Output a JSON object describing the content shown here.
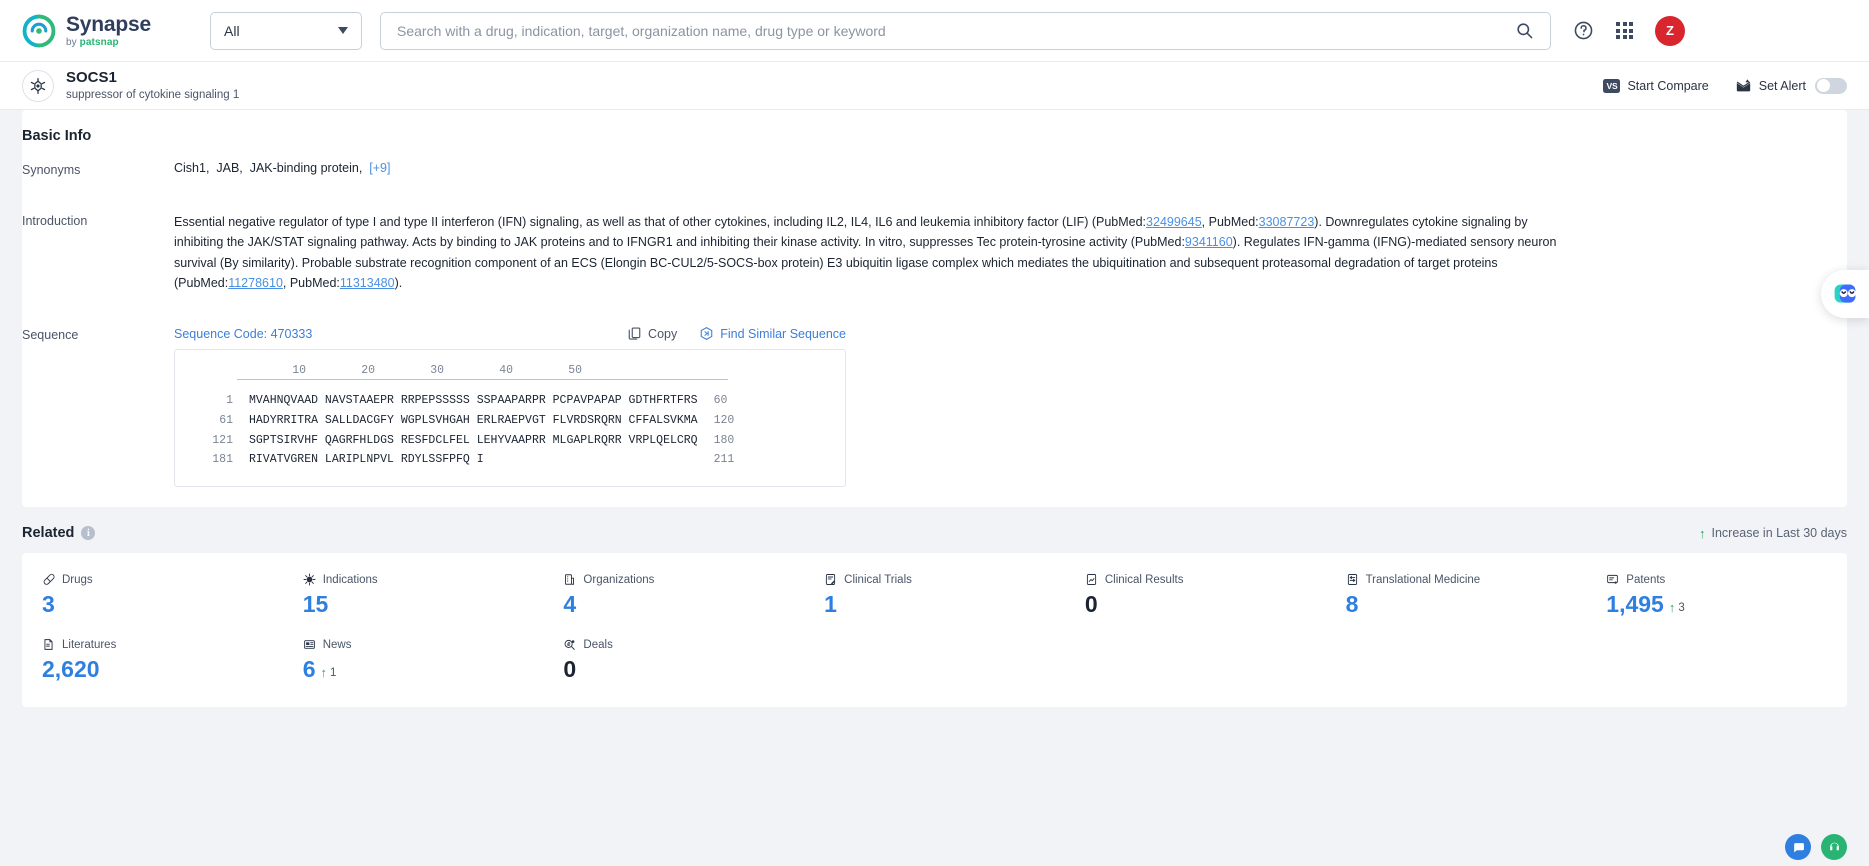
{
  "topbar": {
    "brand_name": "Synapse",
    "brand_by": "by",
    "brand_company": "patsnap",
    "scope_value": "All",
    "search_placeholder": "Search with a drug, indication, target, organization name, drug type or keyword",
    "search_value": "",
    "help_icon": "question-circle-icon",
    "apps_icon": "grid-apps-icon",
    "avatar_initial": "Z"
  },
  "titlebar": {
    "target_icon": "target-crosshair-icon",
    "name": "SOCS1",
    "full_name": "suppressor of cytokine signaling 1",
    "start_compare_label": "Start Compare",
    "vs_badge": "VS",
    "set_alert_label": "Set Alert",
    "alert_enabled": false
  },
  "basic_info": {
    "section_title": "Basic Info",
    "synonyms_label": "Synonyms",
    "synonyms": [
      "Cish1",
      "JAB",
      "JAK-binding protein"
    ],
    "synonyms_more": "[+9]",
    "introduction_label": "Introduction",
    "introduction": {
      "p1": "Essential negative regulator of type I and type II interferon (IFN) signaling, as well as that of other cytokines, including IL2, IL4, IL6 and leukemia inhibitory factor (LIF) (PubMed:",
      "pm1": "32499645",
      "p2": ", PubMed:",
      "pm2": "33087723",
      "p3": "). Downregulates cytokine signaling by inhibiting the JAK/STAT signaling pathway. Acts by binding to JAK proteins and to IFNGR1 and inhibiting their kinase activity. In vitro, suppresses Tec protein-tyrosine activity (PubMed:",
      "pm3": "9341160",
      "p4": "). Regulates IFN-gamma (IFNG)-mediated sensory neuron survival (By similarity). Probable substrate recognition component of an ECS (Elongin BC-CUL2/5-SOCS-box protein) E3 ubiquitin ligase complex which mediates the ubiquitination and subsequent proteasomal degradation of target proteins (PubMed:",
      "pm4": "11278610",
      "p5": ", PubMed:",
      "pm5": "11313480",
      "p6": ")."
    },
    "sequence_label": "Sequence",
    "sequence_code": "Sequence Code: 470333",
    "copy_label": "Copy",
    "copy_icon": "copy-icon",
    "find_similar_label": "Find Similar Sequence",
    "find_similar_icon": "hexagon-similar-icon",
    "sequence_ruler": "        10        20        30        40        50",
    "sequence_rows": [
      {
        "start": "1",
        "blocks": "MVAHNQVAAD NAVSTAAEPR RRPEPSSSSS SSPAAPARPR PCPAVPAPAP GDTHFRTFRS",
        "end": "60"
      },
      {
        "start": "61",
        "blocks": "HADYRRITRA SALLDACGFY WGPLSVHGAH ERLRAEPVGT FLVRDSRQRN CFFALSVKMA",
        "end": "120"
      },
      {
        "start": "121",
        "blocks": "SGPTSIRVHF QAGRFHLDGS RESFDCLFEL LEHYVAAPRR MLGAPLRQRR VRPLQELCRQ",
        "end": "180"
      },
      {
        "start": "181",
        "blocks": "RIVATVGREN LARIPLNPVL RDYLSSFPFQ I",
        "end": "211"
      }
    ]
  },
  "related": {
    "title": "Related",
    "info_icon": "info-circle-icon",
    "legend": "Increase in Last 30 days",
    "legend_icon": "arrow-up-icon",
    "stats": [
      {
        "label": "Drugs",
        "icon": "pill-icon",
        "value": "3",
        "delta": null,
        "zero": false
      },
      {
        "label": "Indications",
        "icon": "virus-icon",
        "value": "15",
        "delta": null,
        "zero": false
      },
      {
        "label": "Organizations",
        "icon": "building-icon",
        "value": "4",
        "delta": null,
        "zero": false
      },
      {
        "label": "Clinical Trials",
        "icon": "clinical-trial-icon",
        "value": "1",
        "delta": null,
        "zero": false
      },
      {
        "label": "Clinical Results",
        "icon": "clinical-result-icon",
        "value": "0",
        "delta": null,
        "zero": true
      },
      {
        "label": "Translational Medicine",
        "icon": "translational-icon",
        "value": "8",
        "delta": null,
        "zero": false
      },
      {
        "label": "Patents",
        "icon": "patent-icon",
        "value": "1,495",
        "delta": "3",
        "zero": false
      },
      {
        "label": "Literatures",
        "icon": "literature-icon",
        "value": "2,620",
        "delta": null,
        "zero": false
      },
      {
        "label": "News",
        "icon": "news-icon",
        "value": "6",
        "delta": "1",
        "zero": false
      },
      {
        "label": "Deals",
        "icon": "deals-icon",
        "value": "0",
        "delta": null,
        "zero": true
      }
    ]
  },
  "assistant": {
    "icon": "ai-assistant-icon"
  },
  "colors": {
    "accent_blue": "#2e7fe0",
    "link_blue": "#4a90e2",
    "increase_green": "#2eaa55",
    "avatar_red": "#d9262e",
    "dark_navy": "#3d4a60"
  }
}
